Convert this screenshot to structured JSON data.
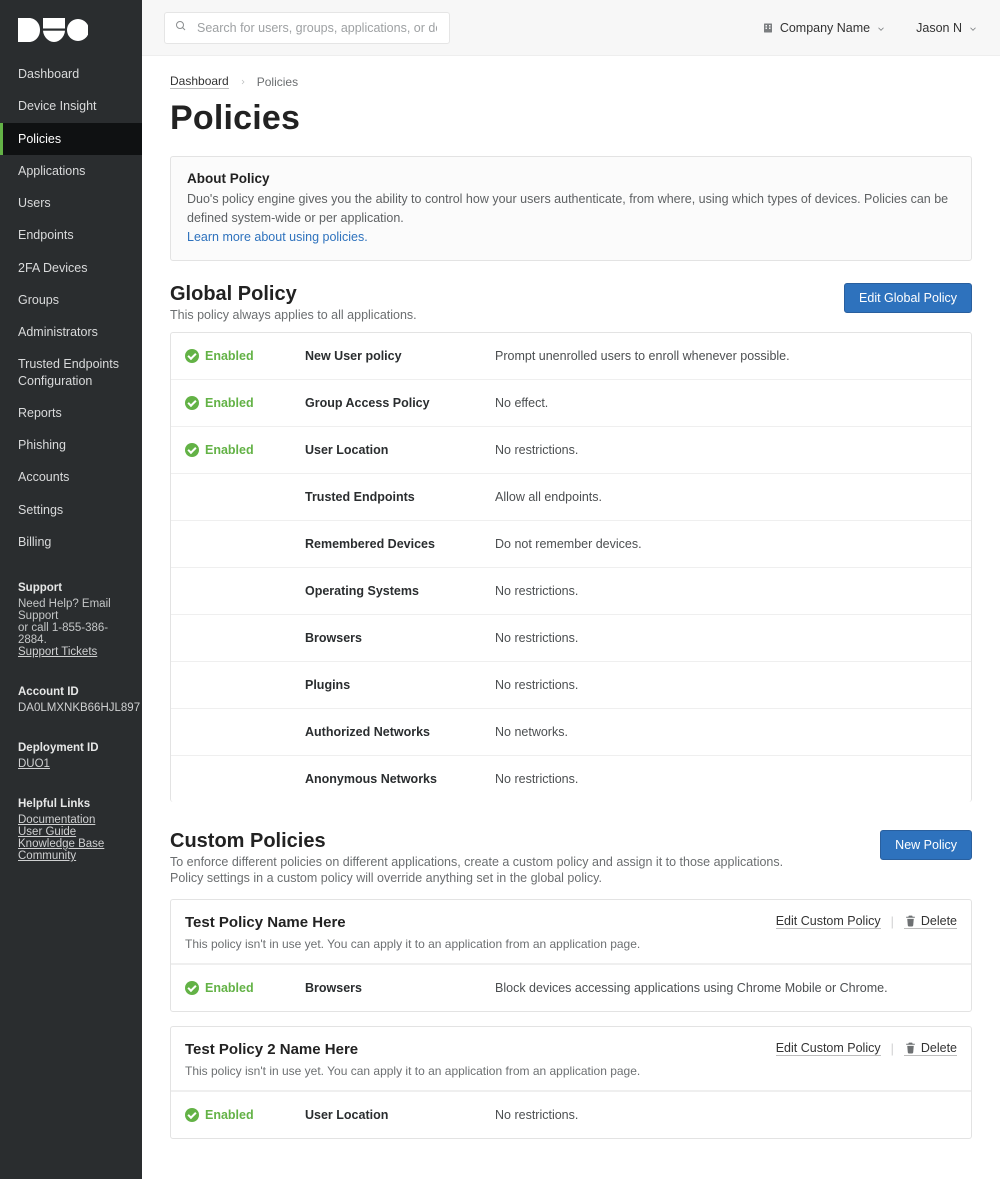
{
  "header": {
    "search_placeholder": "Search for users, groups, applications, or devices",
    "company_label": "Company Name",
    "user_label": "Jason N"
  },
  "breadcrumbs": {
    "home": "Dashboard",
    "current": "Policies"
  },
  "page_title": "Policies",
  "sidebar": {
    "items": [
      {
        "label": "Dashboard"
      },
      {
        "label": "Device Insight"
      },
      {
        "label": "Policies"
      },
      {
        "label": "Applications"
      },
      {
        "label": "Users"
      },
      {
        "label": "Endpoints"
      },
      {
        "label": "2FA Devices"
      },
      {
        "label": "Groups"
      },
      {
        "label": "Administrators"
      },
      {
        "label": "Trusted Endpoints Configuration"
      },
      {
        "label": "Reports"
      },
      {
        "label": "Phishing"
      },
      {
        "label": "Accounts"
      },
      {
        "label": "Settings"
      },
      {
        "label": "Billing"
      }
    ],
    "support": {
      "heading": "Support",
      "line1": "Need Help? Email Support",
      "line2": "or call 1-855-386-2884.",
      "tickets": "Support Tickets"
    },
    "account": {
      "heading": "Account ID",
      "value": "DA0LMXNKB66HJL897"
    },
    "deployment": {
      "heading": "Deployment ID",
      "value": "DUO1"
    },
    "links": {
      "heading": "Helpful Links",
      "items": [
        "Documentation",
        "User Guide",
        "Knowledge Base",
        "Community"
      ]
    }
  },
  "about": {
    "title": "About Policy",
    "body": "Duo's policy engine gives you the ability to control how your users authenticate, from where, using which types of devices. Policies can be defined system-wide or per application.",
    "link": "Learn more about using policies."
  },
  "global": {
    "title": "Global Policy",
    "subtitle": "This policy always applies to all applications.",
    "edit_label": "Edit Global Policy",
    "enabled_label": "Enabled",
    "rows": [
      {
        "enabled": true,
        "name": "New User policy",
        "desc": "Prompt unenrolled users to enroll whenever possible."
      },
      {
        "enabled": true,
        "name": "Group Access Policy",
        "desc": "No effect."
      },
      {
        "enabled": true,
        "name": "User Location",
        "desc": "No restrictions."
      },
      {
        "enabled": false,
        "name": "Trusted Endpoints",
        "desc": "Allow all endpoints."
      },
      {
        "enabled": false,
        "name": "Remembered Devices",
        "desc": "Do not remember devices."
      },
      {
        "enabled": false,
        "name": "Operating Systems",
        "desc": "No restrictions."
      },
      {
        "enabled": false,
        "name": "Browsers",
        "desc": "No restrictions."
      },
      {
        "enabled": false,
        "name": "Plugins",
        "desc": "No restrictions."
      },
      {
        "enabled": false,
        "name": "Authorized Networks",
        "desc": "No networks."
      },
      {
        "enabled": false,
        "name": "Anonymous Networks",
        "desc": "No restrictions."
      }
    ]
  },
  "custom": {
    "title": "Custom Policies",
    "desc1": "To enforce different policies on different applications, create a custom policy and assign it to those applications.",
    "desc2": "Policy settings in a custom policy will override anything set in the global policy.",
    "new_label": "New Policy",
    "edit_label": "Edit Custom Policy",
    "delete_label": "Delete",
    "enabled_label": "Enabled",
    "policies": [
      {
        "name": "Test Policy Name Here",
        "note": "This policy isn't in use yet. You can apply it to an application from an application page.",
        "rows": [
          {
            "enabled": true,
            "name": "Browsers",
            "desc": "Block devices accessing applications using Chrome Mobile or Chrome."
          }
        ]
      },
      {
        "name": "Test Policy 2 Name Here",
        "note": "This policy isn't in use yet. You can apply it to an application from an application page.",
        "rows": [
          {
            "enabled": true,
            "name": "User Location",
            "desc": "No restrictions."
          }
        ]
      }
    ]
  }
}
